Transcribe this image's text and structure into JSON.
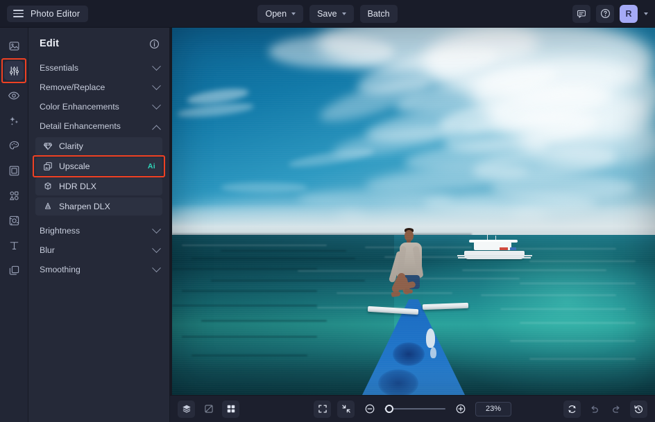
{
  "app": {
    "title": "Photo Editor",
    "menu_icon": "hamburger-icon"
  },
  "topbar": {
    "open_label": "Open",
    "save_label": "Save",
    "batch_label": "Batch",
    "feedback_icon": "chat-bubble-icon",
    "help_icon": "question-circle-icon",
    "avatar_initial": "R"
  },
  "rail": {
    "items": [
      {
        "icon": "image-icon",
        "name": "photos"
      },
      {
        "icon": "sliders-icon",
        "name": "edit"
      },
      {
        "icon": "eye-icon",
        "name": "retouch"
      },
      {
        "icon": "sparkles-icon",
        "name": "effects"
      },
      {
        "icon": "palette-icon",
        "name": "color"
      },
      {
        "icon": "frame-icon",
        "name": "frames"
      },
      {
        "icon": "shapes-icon",
        "name": "shapes"
      },
      {
        "icon": "transform-icon",
        "name": "transform"
      },
      {
        "icon": "text-icon",
        "name": "text"
      },
      {
        "icon": "layers-copy-icon",
        "name": "layers"
      }
    ],
    "active_index": 1,
    "highlight_color": "#ef4123"
  },
  "panel": {
    "title": "Edit",
    "info_icon": "info-circle-icon",
    "groups": [
      {
        "label": "Essentials",
        "expanded": false
      },
      {
        "label": "Remove/Replace",
        "expanded": false
      },
      {
        "label": "Color Enhancements",
        "expanded": false
      },
      {
        "label": "Detail Enhancements",
        "expanded": true
      }
    ],
    "detail_items": [
      {
        "label": "Clarity",
        "icon": "diamond-icon",
        "badge": "",
        "highlighted": false
      },
      {
        "label": "Upscale",
        "icon": "image-expand-icon",
        "badge": "Ai",
        "highlighted": true
      },
      {
        "label": "HDR DLX",
        "icon": "cube-icon",
        "badge": "",
        "highlighted": false
      },
      {
        "label": "Sharpen DLX",
        "icon": "cone-icon",
        "badge": "",
        "highlighted": false
      }
    ],
    "tail_groups": [
      {
        "label": "Brightness",
        "expanded": false
      },
      {
        "label": "Blur",
        "expanded": false
      },
      {
        "label": "Smoothing",
        "expanded": false
      }
    ],
    "badge_color": "#2fd6b9"
  },
  "canvas": {
    "image_alt": "Person sitting on the prow of a blue outrigger boat on turquoise tropical water under a wide cloudy sky"
  },
  "bottombar": {
    "left_tools": [
      {
        "icon": "layers-icon",
        "name": "layers-toggle"
      },
      {
        "icon": "compare-icon",
        "name": "before-after-compare"
      },
      {
        "icon": "grid-icon",
        "name": "grid-view"
      }
    ],
    "view_tools": [
      {
        "icon": "fit-screen-icon",
        "name": "fit-to-screen"
      },
      {
        "icon": "zoom-actual-icon",
        "name": "collapse-view"
      }
    ],
    "zoom_out_icon": "zoom-out-icon",
    "zoom_in_icon": "zoom-in-icon",
    "zoom_value": "23%",
    "zoom_slider_percent": 8,
    "right_tools": [
      {
        "icon": "reset-icon",
        "name": "reset-changes",
        "enabled": true
      },
      {
        "icon": "undo-icon",
        "name": "undo",
        "enabled": false
      },
      {
        "icon": "redo-icon",
        "name": "redo",
        "enabled": false
      },
      {
        "icon": "history-icon",
        "name": "history",
        "enabled": true
      }
    ]
  }
}
